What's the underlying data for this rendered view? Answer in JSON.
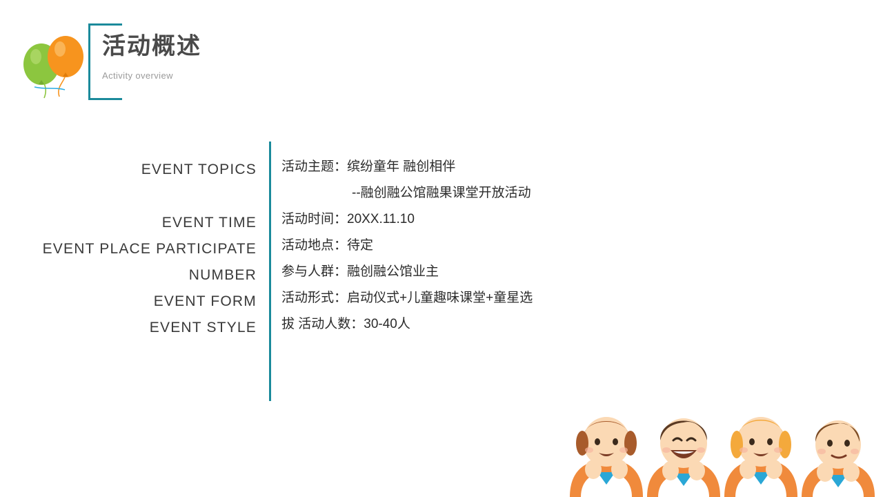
{
  "header": {
    "title_cn": "活动概述",
    "title_en": "Activity overview",
    "accent_color": "#1b8a9b",
    "balloon_green": "#8cc63f",
    "balloon_orange": "#f7941e"
  },
  "labels": [
    "EVENT TOPICS",
    "EVENT TIME",
    "EVENT PLACE  PARTICIPATE",
    "NUMBER",
    "EVENT FORM",
    "EVENT STYLE"
  ],
  "rows": [
    {
      "text": "活动主题：缤纷童年  融创相伴",
      "indent": false
    },
    {
      "text": "--融创融公馆融果课堂开放活动",
      "indent": true
    },
    {
      "text": "活动时间：20XX.11.10",
      "indent": false
    },
    {
      "text": "活动地点：待定",
      "indent": false
    },
    {
      "text": "参与人群：融创融公馆业主",
      "indent": false
    },
    {
      "text": "活动形式：启动仪式+儿童趣味课堂+童星选",
      "indent": false
    },
    {
      "text": "拔 活动人数：30-40人",
      "indent": false
    }
  ]
}
